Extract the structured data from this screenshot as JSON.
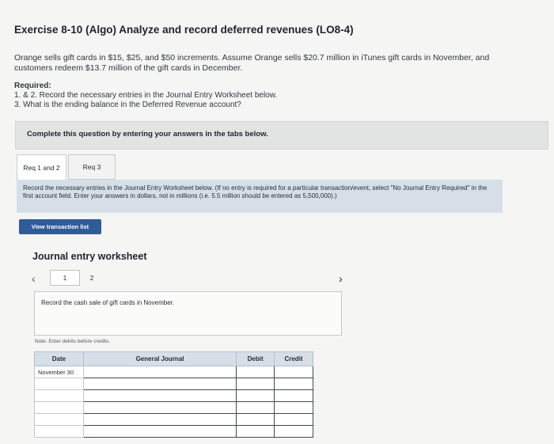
{
  "title": "Exercise 8-10 (Algo) Analyze and record deferred revenues (LO8-4)",
  "problem": {
    "text": "Orange sells gift cards in $15, $25, and $50 increments. Assume Orange sells $20.7 million in iTunes gift cards in November, and customers redeem $13.7 million of the gift cards in December."
  },
  "required": {
    "heading": "Required:",
    "items": [
      "1. & 2. Record the necessary entries in the Journal Entry Worksheet below.",
      "3. What is the ending balance in the Deferred Revenue account?"
    ]
  },
  "complete_bar": "Complete this question by entering your answers in the tabs below.",
  "tabs": [
    {
      "label": "Req 1 and 2",
      "active": true
    },
    {
      "label": "Req 3",
      "active": false
    }
  ],
  "instruction": "Record the necessary entries in the Journal Entry Worksheet below. (If no entry is required for a particular transaction/event, select \"No Journal Entry Required\" in the first account field. Enter your answers in dollars, not in millions (i.e. 5.5 million should be entered as 5,500,000).)",
  "view_button": "View transaction list",
  "worksheet": {
    "title": "Journal entry worksheet",
    "pages": [
      "1",
      "2"
    ],
    "current_page": "1",
    "prev_icon": "chevron-left-icon",
    "next_icon": "chevron-right-icon",
    "transaction": "Record the cash sale of gift cards in November.",
    "note": "Note: Enter debits before credits.",
    "columns": [
      "Date",
      "General Journal",
      "Debit",
      "Credit"
    ],
    "rows": [
      {
        "date": "November 30",
        "account": "",
        "debit": "",
        "credit": ""
      },
      {
        "date": "",
        "account": "",
        "debit": "",
        "credit": ""
      },
      {
        "date": "",
        "account": "",
        "debit": "",
        "credit": ""
      },
      {
        "date": "",
        "account": "",
        "debit": "",
        "credit": ""
      },
      {
        "date": "",
        "account": "",
        "debit": "",
        "credit": ""
      },
      {
        "date": "",
        "account": "",
        "debit": "",
        "credit": ""
      }
    ]
  },
  "colors": {
    "accent_button": "#2f5b97",
    "instruction_bg": "#d6dfe8",
    "header_bg": "#d6dfe8"
  }
}
